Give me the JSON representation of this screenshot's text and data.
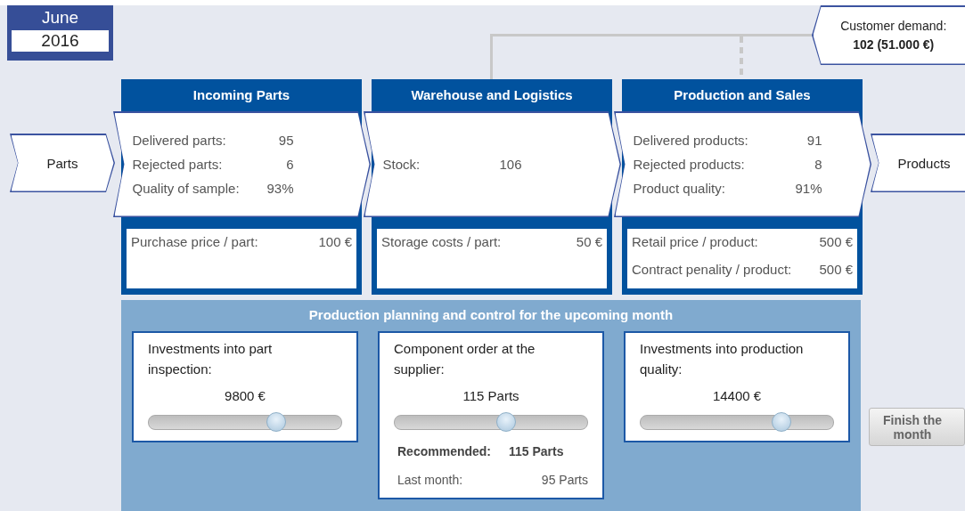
{
  "date": {
    "month": "June",
    "year": "2016"
  },
  "customer_demand": {
    "label": "Customer demand:",
    "value": "102 (51.000 €)"
  },
  "input_flow": {
    "label": "Parts"
  },
  "output_flow": {
    "label": "Products"
  },
  "stages": [
    {
      "title": "Incoming Parts",
      "metrics": [
        {
          "label": "Delivered parts:",
          "value": "95"
        },
        {
          "label": "Rejected parts:",
          "value": "6"
        },
        {
          "label": "Quality of sample:",
          "value": "93%"
        }
      ],
      "costs": [
        {
          "label": "Purchase price / part:",
          "value": "100 €"
        }
      ]
    },
    {
      "title": "Warehouse and Logistics",
      "metrics": [
        {
          "label": "Stock:",
          "value": "106"
        }
      ],
      "costs": [
        {
          "label": "Storage costs / part:",
          "value": "50 €"
        }
      ]
    },
    {
      "title": "Production and Sales",
      "metrics": [
        {
          "label": "Delivered products:",
          "value": "91"
        },
        {
          "label": "Rejected products:",
          "value": "8"
        },
        {
          "label": "Product quality:",
          "value": "91%"
        }
      ],
      "costs": [
        {
          "label": "Retail price / product:",
          "value": "500 €"
        },
        {
          "label": "Contract penality / product:",
          "value": "500 €"
        }
      ]
    }
  ],
  "planning": {
    "title": "Production planning and control for the upcoming month",
    "controls": [
      {
        "label": "Investments into part inspection:",
        "reading": "9800 €",
        "level": 0.66
      },
      {
        "label": "Component order at the supplier:",
        "reading": "115 Parts",
        "level": 0.58,
        "recommended": {
          "label": "Recommended:",
          "value": "115 Parts"
        },
        "last_month": {
          "label": "Last month:",
          "value": "95 Parts"
        }
      },
      {
        "label": "Investments into production quality:",
        "reading": "14400 €",
        "level": 0.73
      }
    ]
  },
  "finish_button": {
    "label": "Finish the month"
  }
}
